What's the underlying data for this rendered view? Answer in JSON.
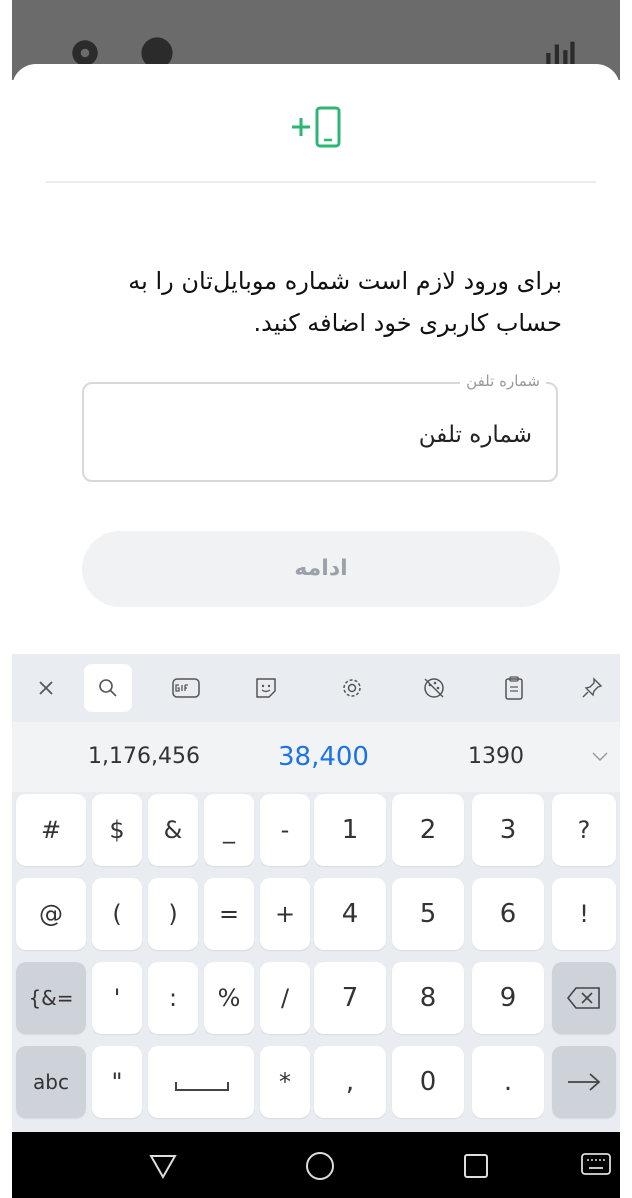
{
  "sheet": {
    "message": "برای ورود لازم است شماره موبایل‌تان را به حساب کاربری خود اضافه کنید.",
    "phone_field": {
      "legend": "شماره تلفن",
      "value": "شماره تلفن"
    },
    "continue_label": "ادامه"
  },
  "keyboard": {
    "suggestions": [
      "1,176,456",
      "38,400",
      "1390"
    ],
    "rows": [
      [
        "#",
        "$",
        "&",
        "_",
        "-",
        "1",
        "2",
        "3",
        "?"
      ],
      [
        "@",
        "(",
        ")",
        "=",
        "+",
        "4",
        "5",
        "6",
        "!"
      ],
      [
        "{&=",
        "'",
        ":",
        "%",
        "/",
        "7",
        "8",
        "9"
      ],
      [
        "abc",
        "\"",
        "*",
        ",",
        "0",
        "."
      ]
    ]
  },
  "colors": {
    "accent": "#2bb673",
    "link_blue": "#1a73e8"
  }
}
